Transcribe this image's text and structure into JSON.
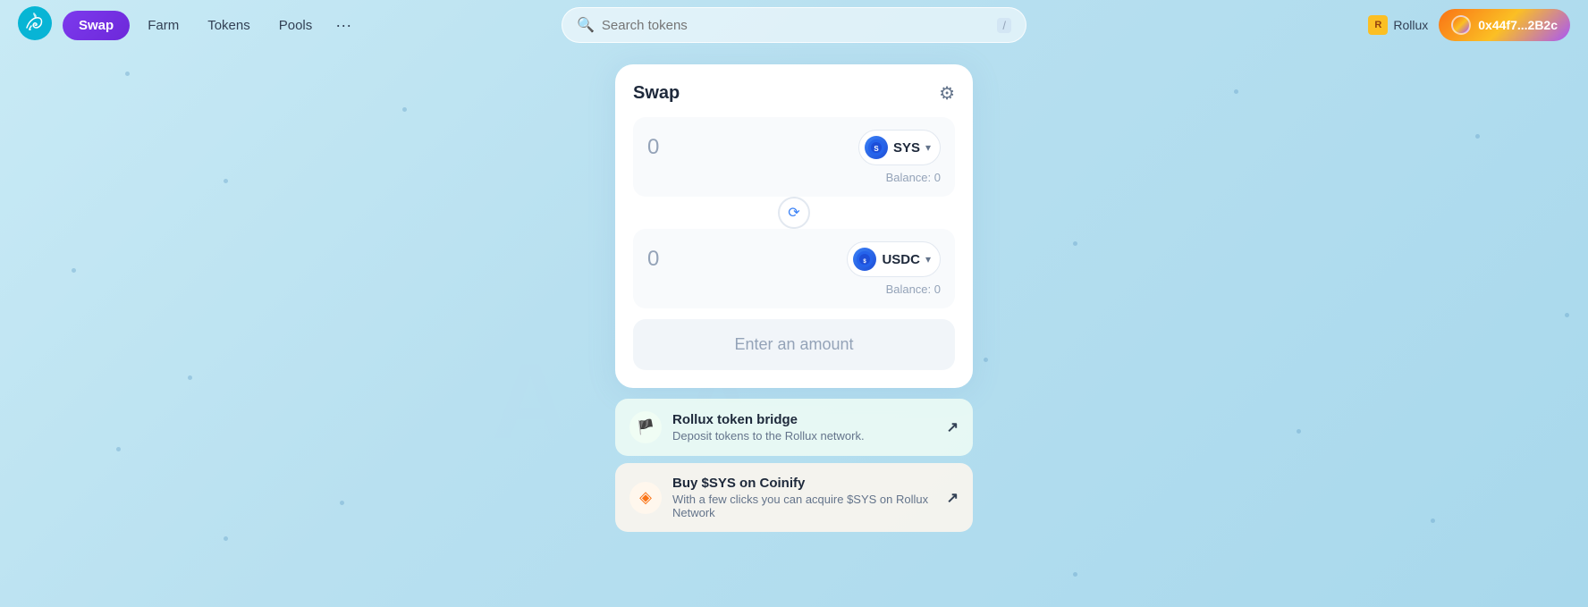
{
  "navbar": {
    "swap_label": "Swap",
    "farm_label": "Farm",
    "tokens_label": "Tokens",
    "pools_label": "Pools",
    "more_label": "···",
    "search_placeholder": "Search tokens",
    "search_shortcut": "/",
    "rollux_label": "Rollux",
    "wallet_address": "0x44f7...2B2c"
  },
  "swap_card": {
    "title": "Swap",
    "settings_icon": "⚙",
    "from_amount": "0",
    "from_token": "SYS",
    "from_balance_label": "Balance: 0",
    "to_amount": "0",
    "to_token": "USDC",
    "to_balance_label": "Balance: 0",
    "swap_arrow": "↻",
    "enter_amount_label": "Enter an amount"
  },
  "info_cards": [
    {
      "title": "Rollux token bridge",
      "description": "Deposit tokens to the Rollux network.",
      "icon": "🏴",
      "arrow": "↗"
    },
    {
      "title": "Buy $SYS on Coinify",
      "description": "With a few clicks you can acquire $SYS on Rollux Network",
      "icon": "◈",
      "arrow": "↗"
    }
  ]
}
